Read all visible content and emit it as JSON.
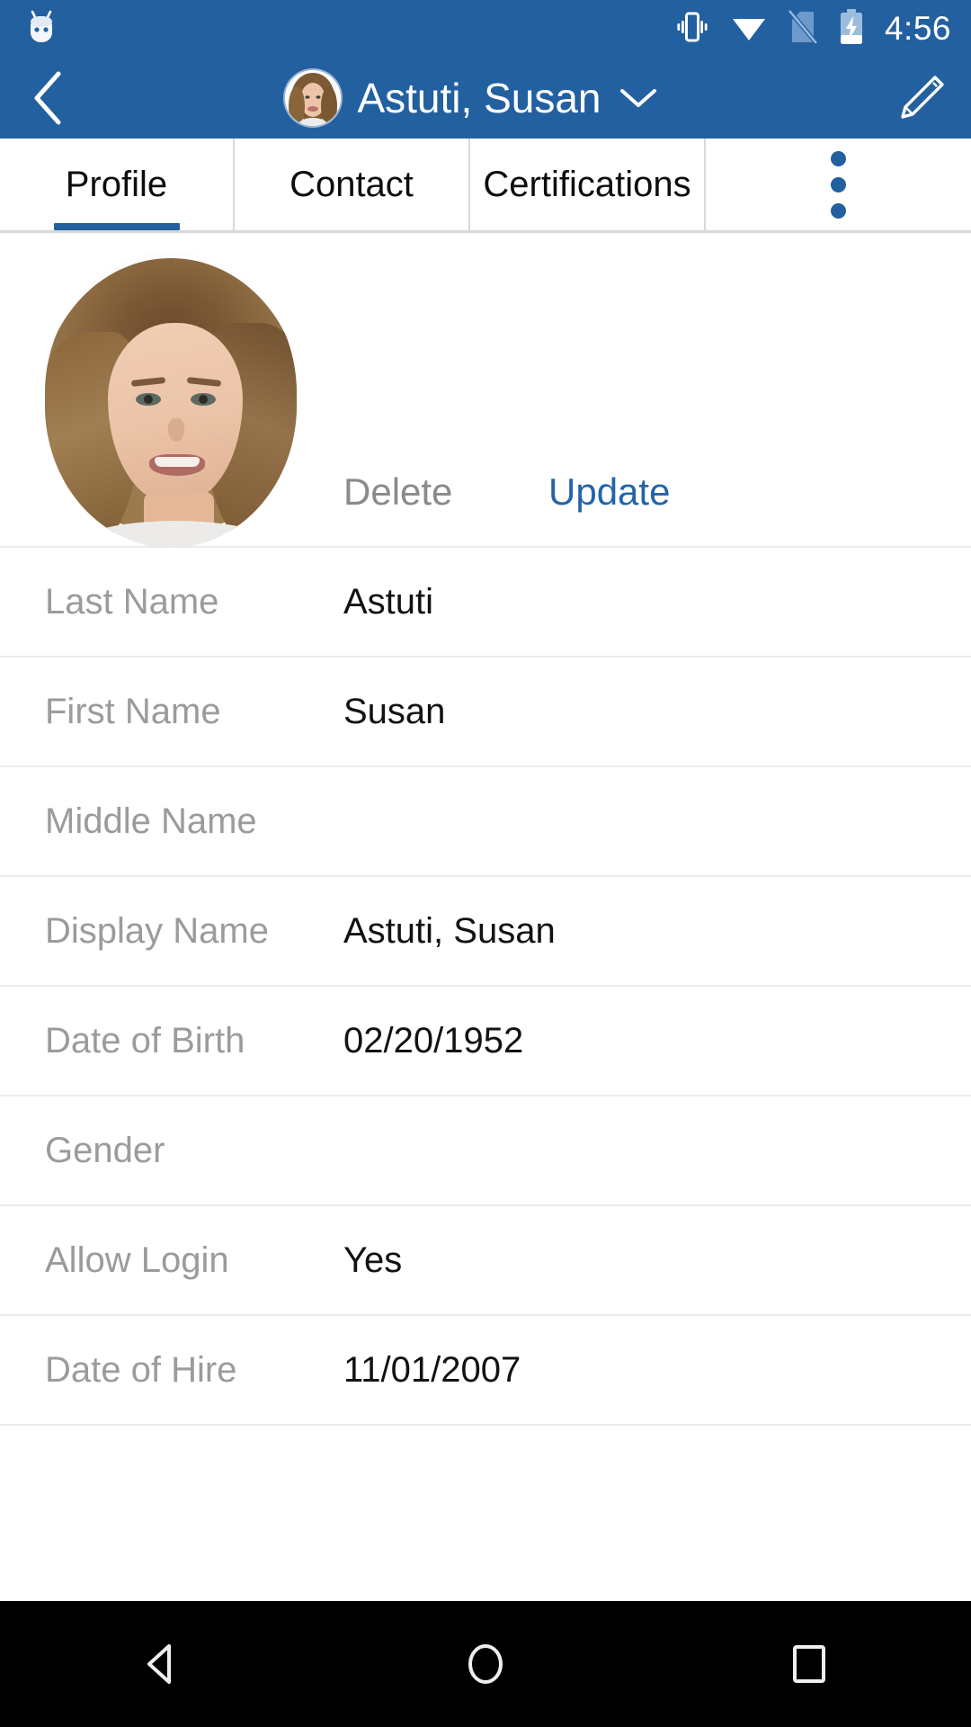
{
  "status_bar": {
    "time": "4:56",
    "icons": [
      "android-robot-icon",
      "vibrate-icon",
      "wifi-icon",
      "no-sim-icon",
      "battery-charging-icon"
    ]
  },
  "app_bar": {
    "back_icon": "chevron-left-icon",
    "title": "Astuti, Susan",
    "dropdown_icon": "chevron-down-icon",
    "edit_icon": "pencil-icon",
    "avatar": "user-avatar",
    "background_color": "#2360A0"
  },
  "tabs": {
    "items": [
      {
        "label": "Profile",
        "active": true
      },
      {
        "label": "Contact",
        "active": false
      },
      {
        "label": "Certifications",
        "active": false
      }
    ],
    "overflow_icon": "kebab-menu-icon",
    "active_indicator_color": "#2360A0"
  },
  "profile": {
    "photo_alt": "profile-photo",
    "actions": {
      "delete_label": "Delete",
      "delete_color": "#8a8a8a",
      "update_label": "Update",
      "update_color": "#2464A8"
    },
    "fields": [
      {
        "label": "Last Name",
        "value": "Astuti"
      },
      {
        "label": "First Name",
        "value": "Susan"
      },
      {
        "label": "Middle Name",
        "value": ""
      },
      {
        "label": "Display Name",
        "value": "Astuti, Susan"
      },
      {
        "label": "Date of Birth",
        "value": "02/20/1952"
      },
      {
        "label": "Gender",
        "value": ""
      },
      {
        "label": "Allow Login",
        "value": "Yes"
      },
      {
        "label": "Date of Hire",
        "value": "11/01/2007"
      }
    ]
  },
  "nav_bar": {
    "back_icon": "triangle-back-icon",
    "home_icon": "circle-home-icon",
    "recents_icon": "square-recents-icon"
  }
}
